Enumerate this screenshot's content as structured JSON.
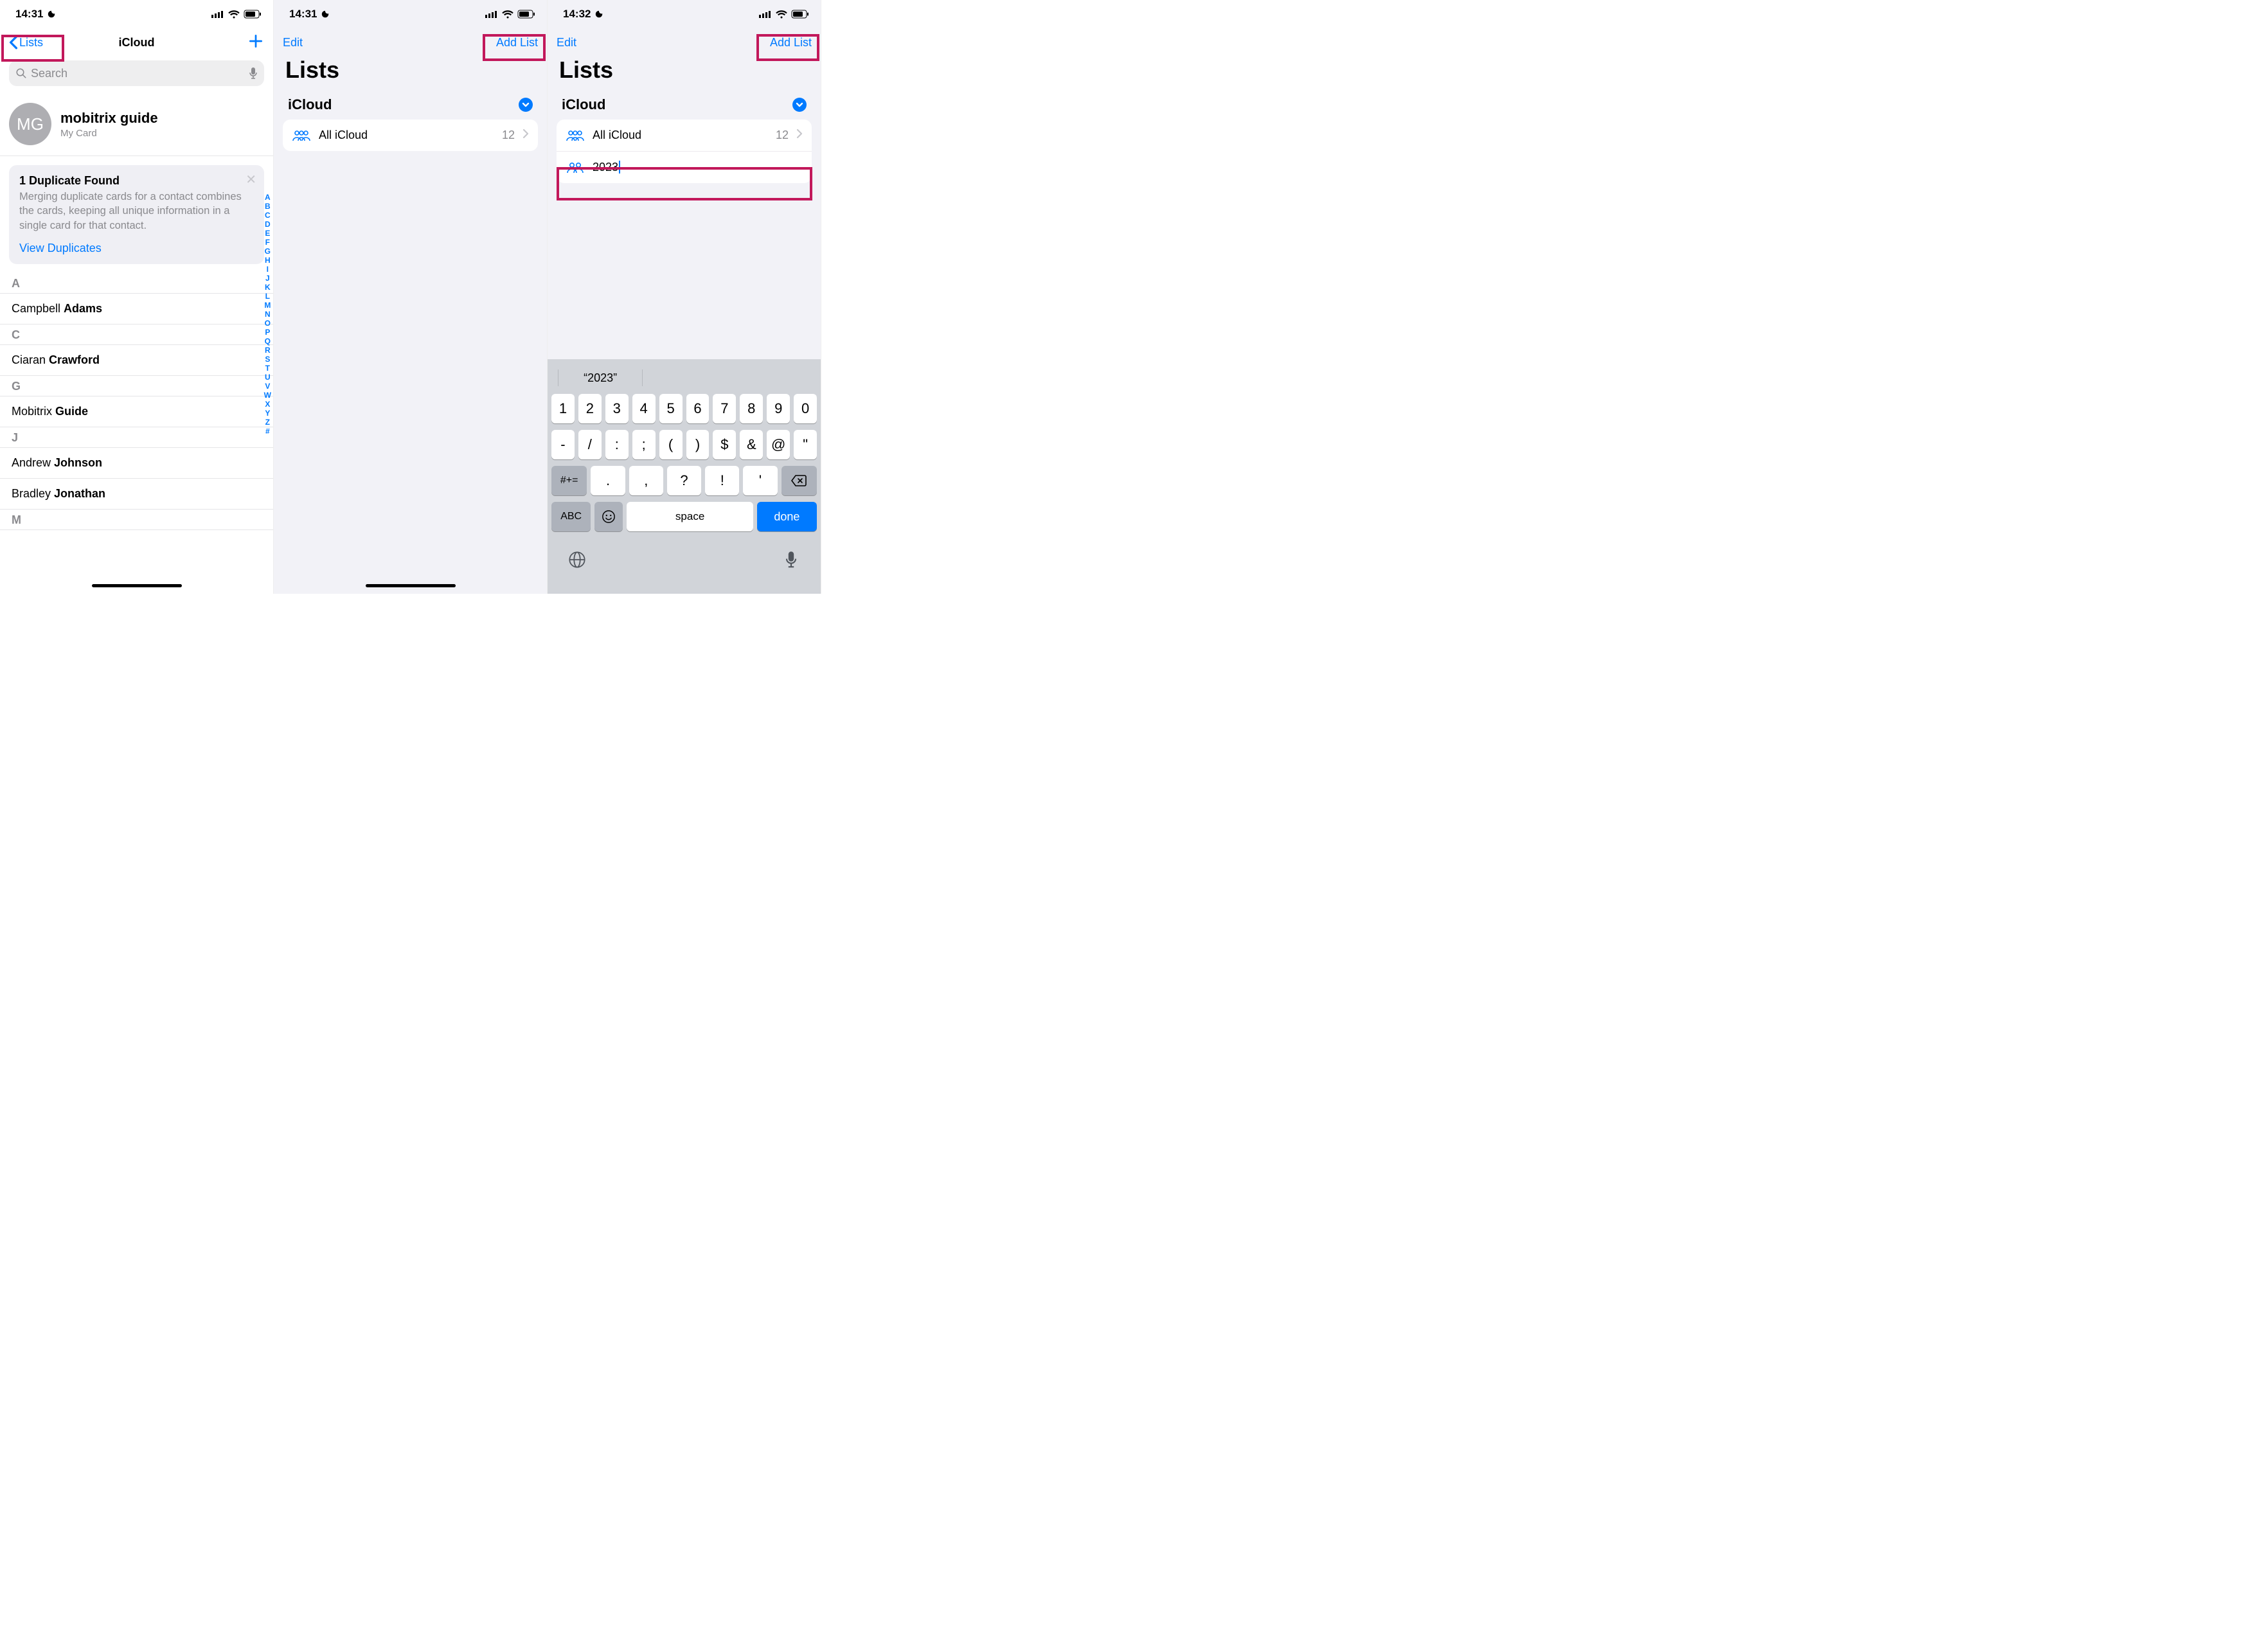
{
  "screen1": {
    "status": {
      "time": "14:31"
    },
    "nav": {
      "back": "Lists",
      "title": "iCloud"
    },
    "search": {
      "placeholder": "Search"
    },
    "mycard": {
      "initials": "MG",
      "name": "mobitrix guide",
      "sub": "My Card"
    },
    "dup": {
      "title": "1 Duplicate Found",
      "body": "Merging duplicate cards for a contact combines the cards, keeping all unique information in a single card for that contact.",
      "link": "View Duplicates"
    },
    "index": [
      "A",
      "B",
      "C",
      "D",
      "E",
      "F",
      "G",
      "H",
      "I",
      "J",
      "K",
      "L",
      "M",
      "N",
      "O",
      "P",
      "Q",
      "R",
      "S",
      "T",
      "U",
      "V",
      "W",
      "X",
      "Y",
      "Z",
      "#"
    ],
    "sections": [
      {
        "letter": "A",
        "rows": [
          {
            "first": "Campbell",
            "last": "Adams"
          }
        ]
      },
      {
        "letter": "C",
        "rows": [
          {
            "first": "Ciaran",
            "last": "Crawford"
          }
        ]
      },
      {
        "letter": "G",
        "rows": [
          {
            "first": "Mobitrix",
            "last": "Guide"
          }
        ]
      },
      {
        "letter": "J",
        "rows": [
          {
            "first": "Andrew",
            "last": "Johnson"
          },
          {
            "first": "Bradley",
            "last": "Jonathan"
          }
        ]
      },
      {
        "letter": "M",
        "rows": []
      }
    ]
  },
  "screen2": {
    "status": {
      "time": "14:31"
    },
    "nav": {
      "left": "Edit",
      "right": "Add List"
    },
    "title": "Lists",
    "group": "iCloud",
    "rows": [
      {
        "icon": "three",
        "label": "All iCloud",
        "count": "12"
      }
    ]
  },
  "screen3": {
    "status": {
      "time": "14:32"
    },
    "nav": {
      "left": "Edit",
      "right": "Add List"
    },
    "title": "Lists",
    "group": "iCloud",
    "rows": [
      {
        "icon": "three",
        "label": "All iCloud",
        "count": "12"
      },
      {
        "icon": "two",
        "input": "2023"
      }
    ],
    "keyboard": {
      "suggestion": "“2023”",
      "row1": [
        "1",
        "2",
        "3",
        "4",
        "5",
        "6",
        "7",
        "8",
        "9",
        "0"
      ],
      "row2": [
        "-",
        "/",
        ":",
        ";",
        "(",
        ")",
        "$",
        "&",
        "@",
        "\""
      ],
      "row3_left": "#+=",
      "row3": [
        ".",
        ",",
        "?",
        "!",
        "'"
      ],
      "row3_right": "backspace",
      "row4": {
        "abc": "ABC",
        "emoji": "emoji",
        "space": "space",
        "done": "done"
      }
    }
  }
}
